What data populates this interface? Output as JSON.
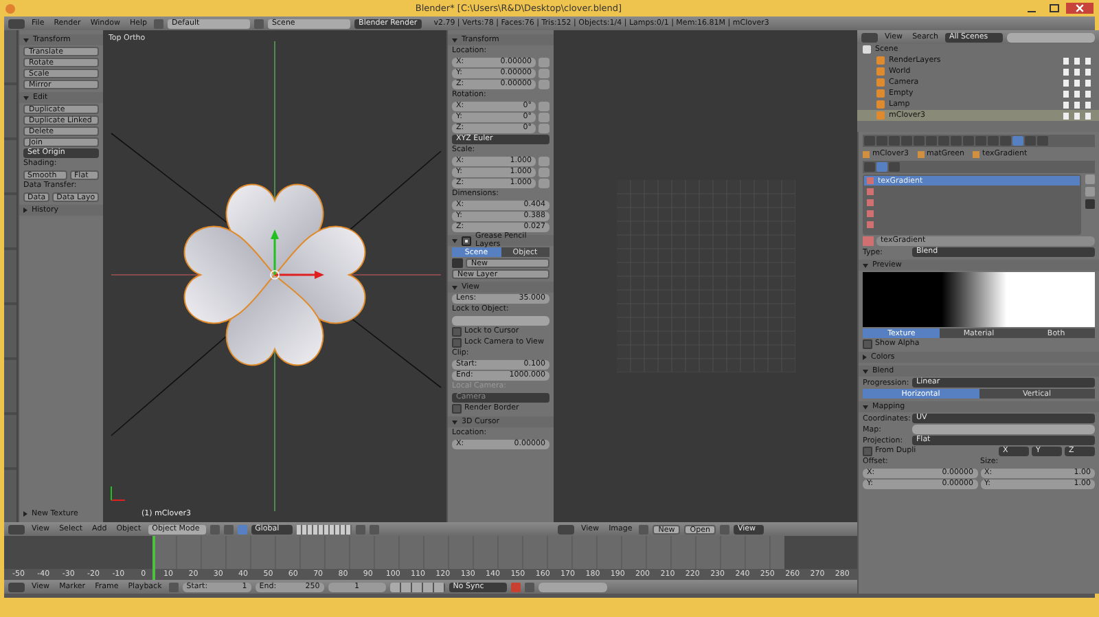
{
  "window": {
    "title": "Blender* [C:\\Users\\R&D\\Desktop\\clover.blend]"
  },
  "info_header": {
    "menus": [
      "File",
      "Render",
      "Window",
      "Help"
    ],
    "layout": "Default",
    "scene": "Scene",
    "engine": "Blender Render",
    "stats": "v2.79 | Verts:78 | Faces:76 | Tris:152 | Objects:1/4 | Lamps:0/1 | Mem:16.81M | mClover3"
  },
  "tool_shelf": {
    "items": [
      {
        "kind": "header",
        "title": "Transform",
        "expanded": true
      },
      {
        "kind": "button",
        "label": "Translate"
      },
      {
        "kind": "button",
        "label": "Rotate"
      },
      {
        "kind": "button",
        "label": "Scale"
      },
      {
        "kind": "button",
        "label": "Mirror"
      },
      {
        "kind": "header",
        "title": "Edit",
        "expanded": true
      },
      {
        "kind": "button",
        "label": "Duplicate"
      },
      {
        "kind": "button",
        "label": "Duplicate Linked"
      },
      {
        "kind": "button",
        "label": "Delete"
      },
      {
        "kind": "button",
        "label": "Join"
      },
      {
        "kind": "dropdown",
        "text": "Set Origin"
      },
      {
        "kind": "label",
        "text": "Shading:"
      },
      {
        "kind": "pair",
        "labels": [
          "Smooth",
          "Flat"
        ]
      },
      {
        "kind": "label",
        "text": "Data Transfer:"
      },
      {
        "kind": "pair",
        "labels": [
          "Data",
          "Data Layo"
        ]
      },
      {
        "kind": "header",
        "title": "History",
        "expanded": false
      }
    ],
    "operator_panel": {
      "title": "New Texture",
      "expanded": false
    }
  },
  "viewport": {
    "view_name": "Top Ortho",
    "object_name": "(1) mClover3"
  },
  "n_panel": {
    "items": [
      {
        "kind": "header",
        "title": "Transform",
        "expanded": true
      },
      {
        "kind": "label",
        "text": "Location:"
      },
      {
        "kind": "lockfield",
        "label": "X:",
        "value": "0.00000"
      },
      {
        "kind": "lockfield",
        "label": "Y:",
        "value": "0.00000"
      },
      {
        "kind": "lockfield",
        "label": "Z:",
        "value": "0.00000"
      },
      {
        "kind": "label",
        "text": "Rotation:"
      },
      {
        "kind": "lockfield",
        "label": "X:",
        "value": "0°"
      },
      {
        "kind": "lockfield",
        "label": "Y:",
        "value": "0°"
      },
      {
        "kind": "lockfield",
        "label": "Z:",
        "value": "0°"
      },
      {
        "kind": "dropdown",
        "text": "XYZ Euler"
      },
      {
        "kind": "label",
        "text": "Scale:"
      },
      {
        "kind": "lockfield",
        "label": "X:",
        "value": "1.000"
      },
      {
        "kind": "lockfield",
        "label": "Y:",
        "value": "1.000"
      },
      {
        "kind": "lockfield",
        "label": "Z:",
        "value": "1.000"
      },
      {
        "kind": "label",
        "text": "Dimensions:"
      },
      {
        "kind": "field",
        "label": "X:",
        "value": "0.404"
      },
      {
        "kind": "field",
        "label": "Y:",
        "value": "0.388"
      },
      {
        "kind": "field",
        "label": "Z:",
        "value": "0.027"
      },
      {
        "kind": "header",
        "title": "Grease Pencil Layers",
        "expanded": true,
        "checked": true
      },
      {
        "kind": "toggle",
        "options": [
          {
            "label": "Scene",
            "selected": true
          },
          {
            "label": "Object",
            "selected": false
          }
        ]
      },
      {
        "kind": "newrow",
        "label": "New"
      },
      {
        "kind": "button",
        "label": "New Layer"
      },
      {
        "kind": "header",
        "title": "View",
        "expanded": true
      },
      {
        "kind": "field",
        "label": "Lens:",
        "value": "35.000"
      },
      {
        "kind": "label",
        "text": "Lock to Object:"
      },
      {
        "kind": "picker"
      },
      {
        "kind": "check",
        "label": "Lock to Cursor",
        "checked": false
      },
      {
        "kind": "check",
        "label": "Lock Camera to View",
        "checked": false
      },
      {
        "kind": "label",
        "text": "Clip:"
      },
      {
        "kind": "field",
        "label": "Start:",
        "value": "0.100"
      },
      {
        "kind": "field",
        "label": "End:",
        "value": "1000.000"
      },
      {
        "kind": "label",
        "text": "Local Camera:",
        "disabled": true
      },
      {
        "kind": "dropdown",
        "text": "Camera",
        "disabled": true
      },
      {
        "kind": "check",
        "label": "Render Border",
        "checked": false
      },
      {
        "kind": "header",
        "title": "3D Cursor",
        "expanded": true
      },
      {
        "kind": "label",
        "text": "Location:"
      },
      {
        "kind": "field",
        "label": "X:",
        "value": "0.00000"
      }
    ]
  },
  "image_editor": {
    "menus": [
      "View",
      "Image"
    ],
    "new_button": "New",
    "open_button": "Open",
    "view_mode": "View"
  },
  "view3d_header": {
    "menus": [
      "View",
      "Select",
      "Add",
      "Object"
    ],
    "mode": "Object Mode",
    "orientation": "Global"
  },
  "outliner": {
    "menus": [
      "View",
      "Search"
    ],
    "filter": "All Scenes",
    "tree": [
      {
        "label": "Scene",
        "selected": false,
        "children": [
          {
            "label": "RenderLayers",
            "selected": false
          },
          {
            "label": "World",
            "selected": false
          },
          {
            "label": "Camera",
            "selected": false
          },
          {
            "label": "Empty",
            "selected": false
          },
          {
            "label": "Lamp",
            "selected": false
          },
          {
            "label": "mClover3",
            "selected": true
          }
        ]
      }
    ]
  },
  "properties": {
    "context_tabs": [
      {
        "selected": false
      },
      {
        "selected": false
      },
      {
        "selected": false
      },
      {
        "selected": false
      },
      {
        "selected": false
      },
      {
        "selected": false
      },
      {
        "selected": false
      },
      {
        "selected": false
      },
      {
        "selected": false
      },
      {
        "selected": false
      },
      {
        "selected": false
      },
      {
        "selected": false
      },
      {
        "selected": true
      },
      {
        "selected": false
      },
      {
        "selected": false
      }
    ],
    "breadcrumb": [
      "mClover3",
      "matGreen",
      "texGradient"
    ],
    "slots": [
      {
        "name": "texGradient",
        "selected": true
      },
      {
        "selected": false
      },
      {
        "selected": false
      },
      {
        "selected": false
      },
      {
        "selected": false
      }
    ],
    "texture_name": "texGradient",
    "items": [
      {
        "kind": "dropdown",
        "label": "Type:",
        "text": "Blend"
      },
      {
        "kind": "header",
        "title": "Preview",
        "expanded": true
      },
      {
        "kind": "preview"
      },
      {
        "kind": "toggle",
        "options": [
          {
            "label": "Texture",
            "selected": true
          },
          {
            "label": "Material",
            "selected": false
          },
          {
            "label": "Both",
            "selected": false
          }
        ]
      },
      {
        "kind": "check",
        "label": "Show Alpha",
        "checked": false
      },
      {
        "kind": "header",
        "title": "Colors",
        "expanded": false
      },
      {
        "kind": "header",
        "title": "Blend",
        "expanded": true
      },
      {
        "kind": "dropdown",
        "label": "Progression:",
        "text": "Linear"
      },
      {
        "kind": "toggle",
        "options": [
          {
            "label": "Horizontal",
            "selected": true
          },
          {
            "label": "Vertical",
            "selected": false
          }
        ]
      },
      {
        "kind": "header",
        "title": "Mapping",
        "expanded": true
      },
      {
        "kind": "dropdown",
        "label": "Coordinates:",
        "text": "UV"
      },
      {
        "kind": "picker",
        "label": "Map:"
      },
      {
        "kind": "dropdown",
        "label": "Projection:",
        "text": "Flat"
      },
      {
        "kind": "checkdrops",
        "label": "From Dupli",
        "checked": false,
        "options": [
          "X",
          "Y",
          "Z"
        ]
      },
      {
        "kind": "labelpair",
        "labels": [
          "Offset:",
          "Size:"
        ]
      },
      {
        "kind": "fieldpair",
        "fields": [
          {
            "label": "X:",
            "value": "0.00000"
          },
          {
            "label": "X:",
            "value": "1.00"
          }
        ]
      },
      {
        "kind": "fieldpair",
        "fields": [
          {
            "label": "Y:",
            "value": "0.00000"
          },
          {
            "label": "Y:",
            "value": "1.00"
          }
        ]
      }
    ]
  },
  "timeline": {
    "ticks": [
      "-50",
      "-40",
      "-30",
      "-20",
      "-10",
      "0",
      "10",
      "20",
      "30",
      "40",
      "50",
      "60",
      "70",
      "80",
      "90",
      "100",
      "110",
      "120",
      "130",
      "140",
      "150",
      "160",
      "170",
      "180",
      "190",
      "200",
      "210",
      "220",
      "230",
      "240",
      "250",
      "260",
      "270",
      "280"
    ]
  },
  "timeline_header": {
    "menus": [
      "View",
      "Marker",
      "Frame",
      "Playback"
    ],
    "start_label": "Start:",
    "start": "1",
    "end_label": "End:",
    "end": "250",
    "current": "1",
    "sync": "No Sync"
  }
}
